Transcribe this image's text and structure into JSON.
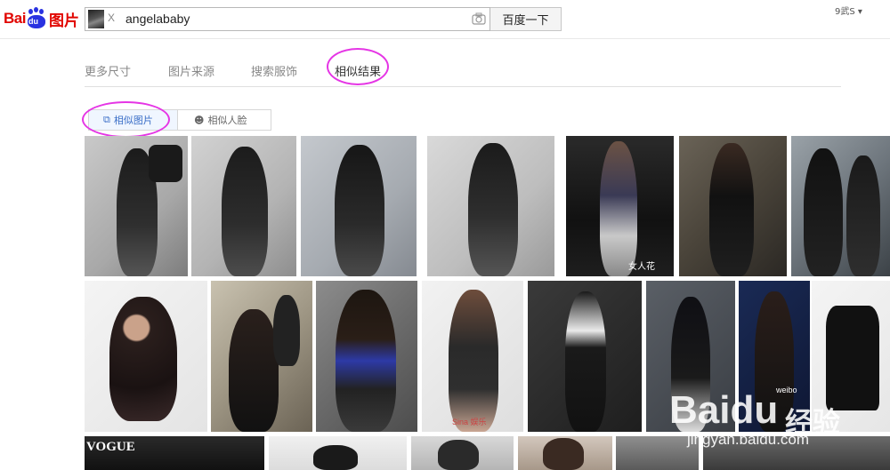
{
  "header": {
    "logo_text": "Bai",
    "logo_du": "du",
    "logo_product": "图片",
    "search_thumb_close": "X",
    "search_query": "angelababy",
    "search_button": "百度一下",
    "user_menu": "9武S ▾"
  },
  "tabs": [
    {
      "label": "更多尺寸",
      "active": false
    },
    {
      "label": "图片来源",
      "active": false
    },
    {
      "label": "搜索服饰",
      "active": false
    },
    {
      "label": "相似结果",
      "active": true
    }
  ],
  "subtabs": [
    {
      "label": "相似图片",
      "icon": "copy-icon",
      "active": true
    },
    {
      "label": "相似人脸",
      "icon": "face-icon",
      "active": false
    }
  ],
  "captions": {
    "r1c6": "女人花",
    "r2c4": "Sina 娱乐",
    "r2c10": "weibo",
    "r3c1": "VOGUE"
  },
  "watermark": {
    "brand": "Baidu",
    "product": "经验",
    "url": "jingyan.baidu.com"
  },
  "colors": {
    "accent": "#3b6fc7",
    "logo_red": "#e10601",
    "logo_blue": "#2932e1",
    "annotation": "#e535e5"
  }
}
